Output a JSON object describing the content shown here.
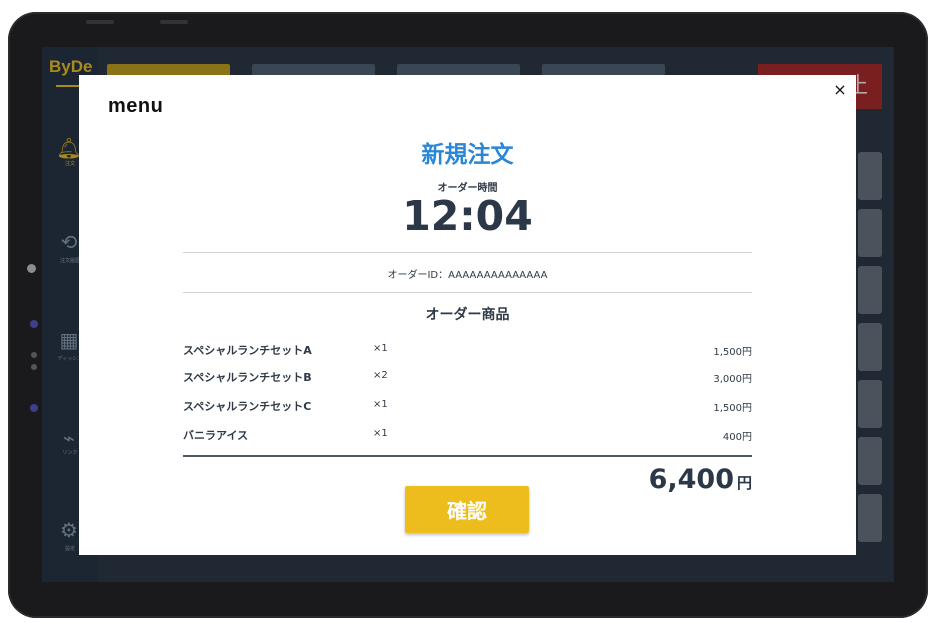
{
  "app": {
    "brand": "ByDe",
    "sidebar": [
      {
        "icon": "bell-icon",
        "label": "注文"
      },
      {
        "icon": "history-icon",
        "label": "注文履歴"
      },
      {
        "icon": "grid-icon",
        "label": "ディッシュ"
      },
      {
        "icon": "link-icon",
        "label": "リンク"
      },
      {
        "icon": "gear-icon",
        "label": "設定"
      }
    ],
    "cancel_tab_label": "止"
  },
  "modal": {
    "logo": "menu",
    "close_symbol": "×",
    "title": "新規注文",
    "order_time_label": "オーダー時間",
    "order_time": "12:04",
    "order_id_text": "オーダーID：AAAAAAAAAAAAAA",
    "items_heading": "オーダー商品",
    "items": [
      {
        "name": "スペシャルランチセットA",
        "qty": "×1",
        "price": "1,500円"
      },
      {
        "name": "スペシャルランチセットB",
        "qty": "×2",
        "price": "3,000円"
      },
      {
        "name": "スペシャルランチセットC",
        "qty": "×1",
        "price": "1,500円"
      },
      {
        "name": "バニラアイス",
        "qty": "×1",
        "price": "400円"
      }
    ],
    "total_amount": "6,400",
    "total_unit": "円",
    "confirm_label": "確認"
  },
  "colors": {
    "title": "#2a86d6",
    "confirm_button": "#edbc1d",
    "accent": "#a88b1a"
  }
}
